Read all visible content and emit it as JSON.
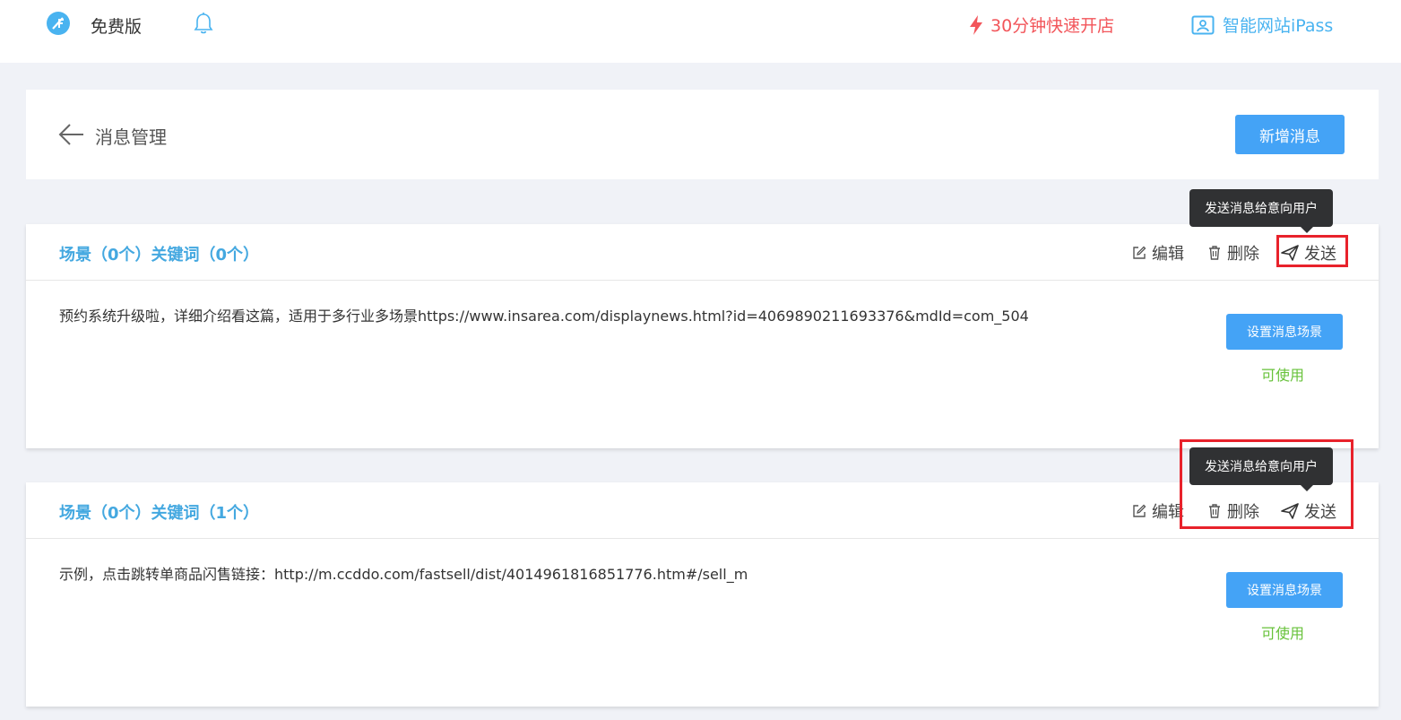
{
  "topbar": {
    "edition": "免费版",
    "promo_label": "30分钟快速开店",
    "ipass_label": "智能网站iPass",
    "accent_color": "#49b3f0",
    "promo_color": "#f2555a"
  },
  "header": {
    "title": "消息管理",
    "add_button": "新增消息"
  },
  "messages": [
    {
      "title": "场景（0个）关键词（0个）",
      "edit_label": "编辑",
      "delete_label": "删除",
      "send_label": "发送",
      "text": "预约系统升级啦，详细介绍看这篇，适用于多行业多场景https://www.insarea.com/displaynews.html?id=4069890211693376&mdId=com_504",
      "scene_button": "设置消息场景",
      "status": "可使用",
      "tooltip": "发送消息给意向用户"
    },
    {
      "title": "场景（0个）关键词（1个）",
      "edit_label": "编辑",
      "delete_label": "删除",
      "send_label": "发送",
      "text": "示例，点击跳转单商品闪售链接：http://m.ccddo.com/fastsell/dist/4014961816851776.htm#/sell_m",
      "scene_button": "设置消息场景",
      "status": "可使用",
      "tooltip": "发送消息给意向用户"
    }
  ],
  "icons": {
    "logo": "app-logo",
    "bell": "bell-icon",
    "promo": "lightning-icon",
    "ipass": "portrait-frame-icon",
    "back": "arrow-left-icon",
    "edit": "edit-icon",
    "delete": "trash-icon",
    "send": "paper-plane-icon"
  },
  "status_color": "#67c23a",
  "highlight_color": "#e8222b"
}
